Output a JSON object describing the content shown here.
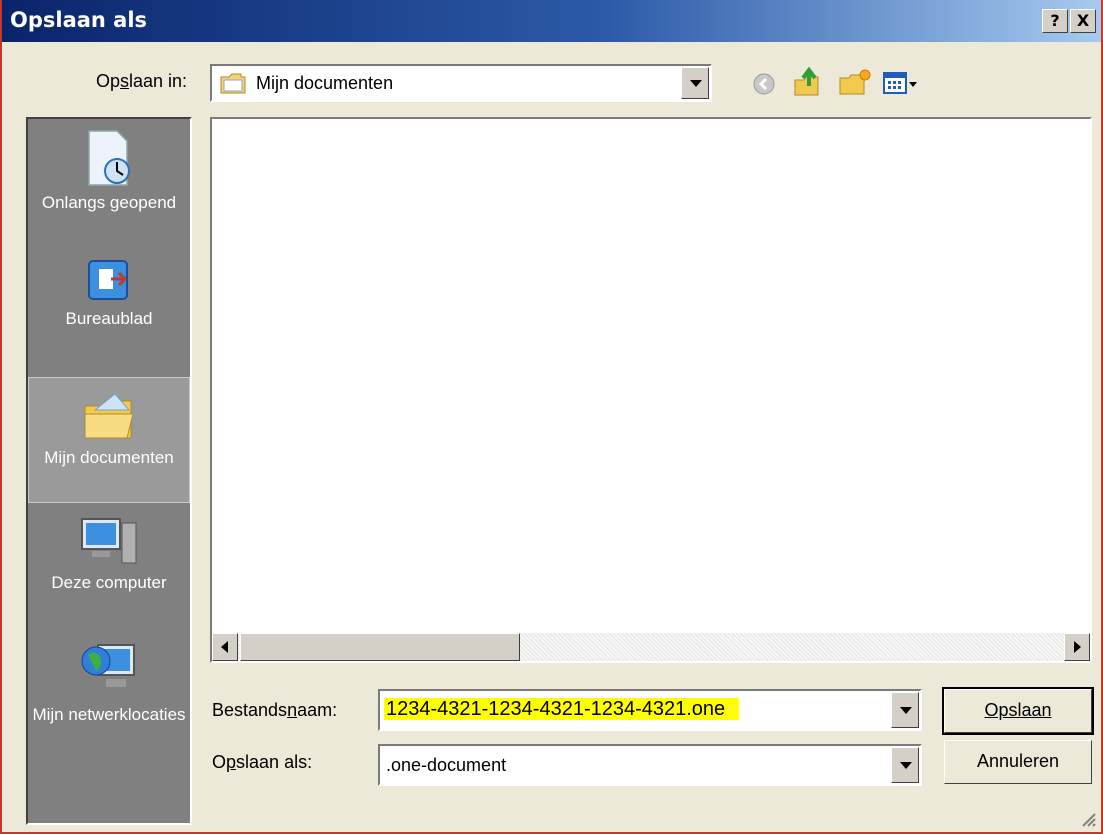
{
  "window": {
    "title": "Opslaan als",
    "help_glyph": "?",
    "close_glyph": "X"
  },
  "toolbar": {
    "save_in_label": "Opslaan in:",
    "save_in_value": "Mijn documenten",
    "icons": [
      "back-icon",
      "up-folder-icon",
      "new-folder-icon",
      "view-menu-icon"
    ]
  },
  "places": [
    {
      "label": "Onlangs geopend",
      "icon": "recent-documents-icon"
    },
    {
      "label": "Bureaublad",
      "icon": "desktop-icon"
    },
    {
      "label": "Mijn documenten",
      "icon": "my-documents-icon",
      "selected": true
    },
    {
      "label": "Deze computer",
      "icon": "my-computer-icon"
    },
    {
      "label": "Mijn netwerklocaties",
      "icon": "network-places-icon"
    }
  ],
  "form": {
    "filename_label": "Bestandsnaam:",
    "filename_value": "1234-4321-1234-4321-1234-4321.one",
    "type_label": "Opslaan als:",
    "type_value": ".one-document"
  },
  "buttons": {
    "save": "Opslaan",
    "cancel": "Annuleren"
  },
  "colors": {
    "titlebar_start": "#0a246a",
    "titlebar_end": "#a6caf0",
    "highlight": "#ffff00",
    "places_bg": "#808080"
  }
}
